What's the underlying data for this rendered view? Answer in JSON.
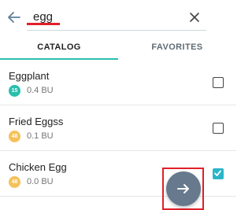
{
  "search": {
    "value": "egg"
  },
  "tabs": [
    {
      "label": "CATALOG",
      "active": true
    },
    {
      "label": "FAVORITES",
      "active": false
    }
  ],
  "items": [
    {
      "name": "Eggplant",
      "badge": "15",
      "badge_color": "#29bfad",
      "bu": "0.4 BU",
      "checked": false
    },
    {
      "name": "Fried Eggss",
      "badge": "48",
      "badge_color": "#f5c15a",
      "bu": "0.1 BU",
      "checked": false
    },
    {
      "name": "Chicken Egg",
      "badge": "48",
      "badge_color": "#f5c15a",
      "bu": "0.0 BU",
      "checked": true
    }
  ],
  "icons": {
    "back": "arrow-left-icon",
    "clear": "close-icon",
    "fab": "arrow-right-icon",
    "check": "checkmark-icon"
  },
  "colors": {
    "accent": "#29bfad",
    "checkbox_checked": "#2bb5c8",
    "fab": "#66798d",
    "highlight": "#e0202a"
  }
}
